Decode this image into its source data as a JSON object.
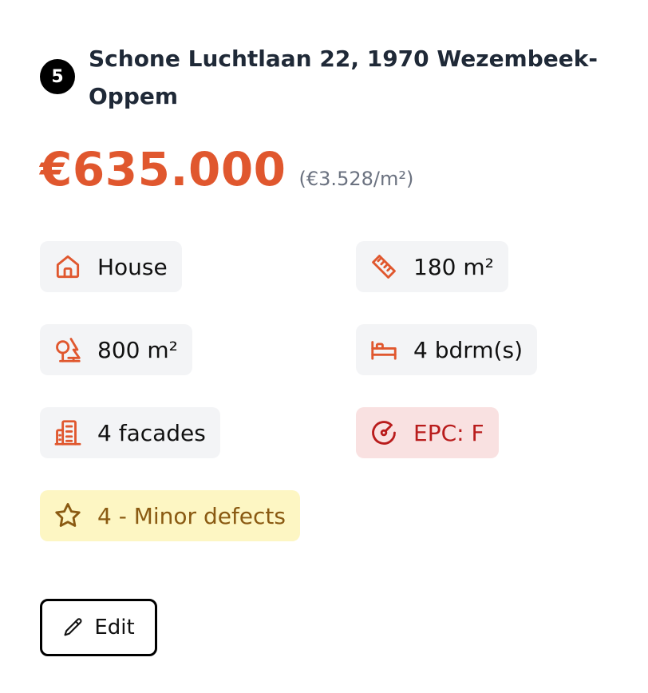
{
  "listing": {
    "rank": "5",
    "address": "Schone Luchtlaan 22, 1970 Wezembeek-Oppem",
    "price": "€635.000",
    "price_per_m2": "(€3.528/m²)"
  },
  "features": {
    "type": {
      "label": "House",
      "icon": "house-icon"
    },
    "living_area": {
      "label": "180 m²",
      "icon": "ruler-icon"
    },
    "plot_area": {
      "label": "800 m²",
      "icon": "trees-icon"
    },
    "bedrooms": {
      "label": "4 bdrm(s)",
      "icon": "bed-icon"
    },
    "facades": {
      "label": "4 facades",
      "icon": "building-icon"
    },
    "epc": {
      "label": "EPC: F",
      "icon": "gauge-icon"
    },
    "condition": {
      "label": "4 - Minor defects",
      "icon": "star-icon"
    }
  },
  "actions": {
    "edit_label": "Edit",
    "edit_icon": "pencil-icon"
  },
  "colors": {
    "accent": "#e0572e",
    "chip_bg": "#f3f4f6",
    "epc_bg": "#f9e1e1",
    "epc_text": "#b91c1c",
    "condition_bg": "#fdf6c3",
    "condition_text": "#8a5a12"
  }
}
